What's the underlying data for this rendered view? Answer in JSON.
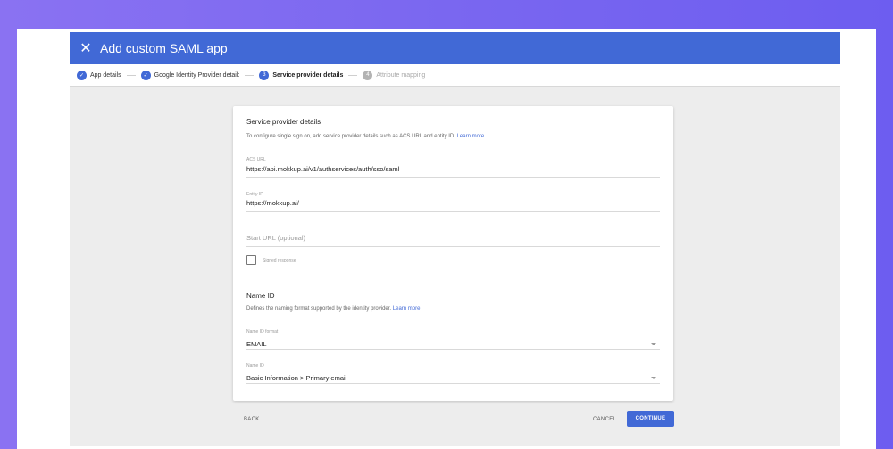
{
  "header": {
    "title": "Add custom SAML app"
  },
  "stepper": {
    "steps": [
      {
        "label": "App details",
        "marker": "✓"
      },
      {
        "label": "Google Identity Provider detail:",
        "marker": "✓"
      },
      {
        "label": "Service provider details",
        "marker": "3"
      },
      {
        "label": "Attribute mapping",
        "marker": "4"
      }
    ]
  },
  "card": {
    "title": "Service provider details",
    "description": "To configure single sign on, add service provider details such as ACS URL and entity ID.",
    "learn_more": "Learn more",
    "acs_url": {
      "label": "ACS URL",
      "value": "https://api.mokkup.ai/v1/authservices/auth/sso/saml"
    },
    "entity_id": {
      "label": "Entity ID",
      "value": "https://mokkup.ai/"
    },
    "start_url": {
      "placeholder": "Start URL (optional)"
    },
    "signed_response": {
      "label": "Signed response"
    },
    "name_id": {
      "title": "Name ID",
      "description": "Defines the naming format supported by the identity provider.",
      "learn_more": "Learn more",
      "format": {
        "label": "Name ID format",
        "value": "EMAIL"
      },
      "name": {
        "label": "Name ID",
        "value": "Basic Information > Primary email"
      }
    }
  },
  "footer": {
    "back": "BACK",
    "cancel": "CANCEL",
    "continue": "CONTINUE"
  },
  "colors": {
    "primary": "#4169d6",
    "background_gradient_start": "#8a72f2",
    "background_gradient_end": "#6d5df0"
  }
}
